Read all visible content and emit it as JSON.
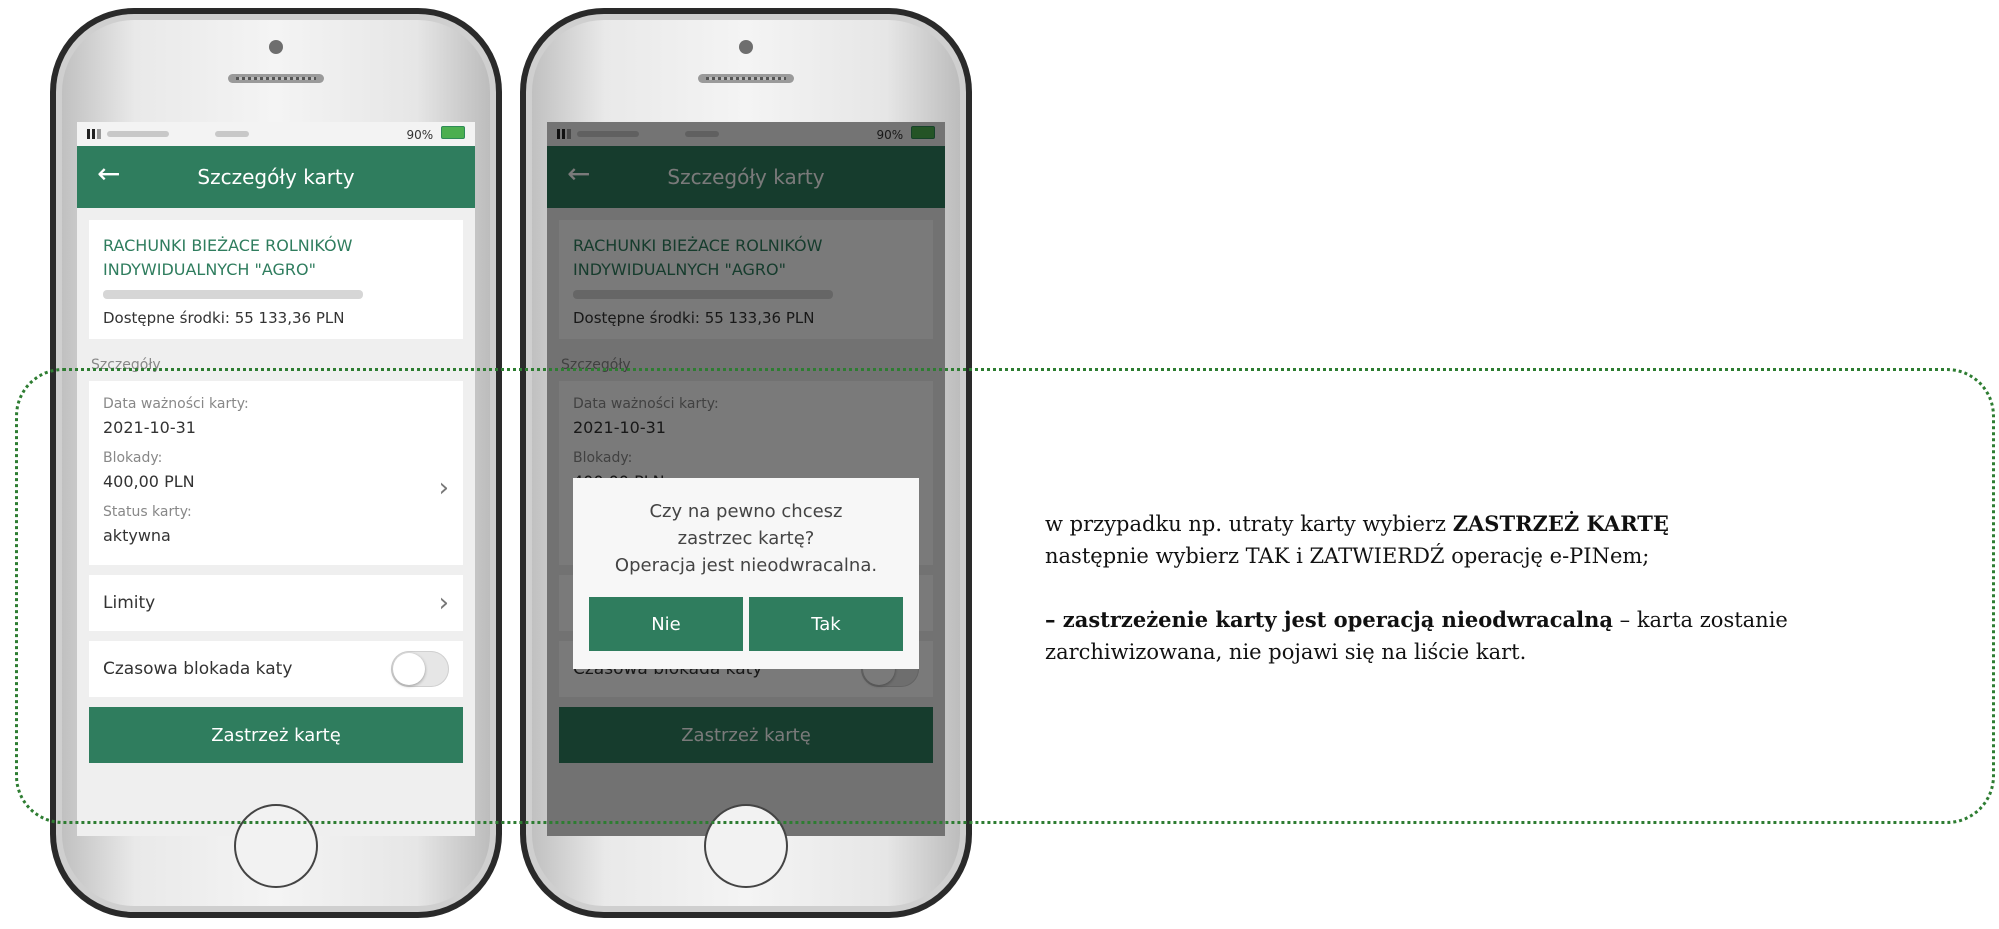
{
  "status_bar": {
    "battery": "90%"
  },
  "app": {
    "title": "Szczegóły karty",
    "back_icon": "arrow-left-icon",
    "account": {
      "name": "RACHUNKI BIEŻACE ROLNIKÓW INDYWIDUALNYCH \"AGRO\"",
      "funds": "Dostępne środki: 55 133,36 PLN"
    },
    "section_label": "Szczegóły",
    "details": [
      {
        "label": "Data ważności karty:",
        "value": "2021-10-31"
      },
      {
        "label": "Blokady:",
        "value": "400,00 PLN"
      },
      {
        "label": "Status karty:",
        "value": "aktywna"
      }
    ],
    "limits_label": "Limity",
    "temp_block_label": "Czasowa blokada katy",
    "restrict_button": "Zastrzeż kartę"
  },
  "dialog": {
    "line1": "Czy na pewno chcesz",
    "line2": "zastrzec kartę?",
    "line3": "Operacja jest nieodwracalna.",
    "no": "Nie",
    "yes": "Tak"
  },
  "instructions": {
    "p1_pre": "w przypadku np. utraty karty wybierz ",
    "p1_bold": "ZASTRZEŻ KARTĘ",
    "p1_line2": "następnie wybierz TAK i ZATWIERDŹ operację e-PINem;",
    "p2_bold": "– zastrzeżenie karty jest operacją nieodwracalną",
    "p2_rest": " – karta zostanie",
    "p2_line2": "zarchiwizowana, nie pojawi się na liście kart."
  },
  "colors": {
    "brand_green": "#2f7d5e",
    "frame_dots": "#2e7d32"
  }
}
